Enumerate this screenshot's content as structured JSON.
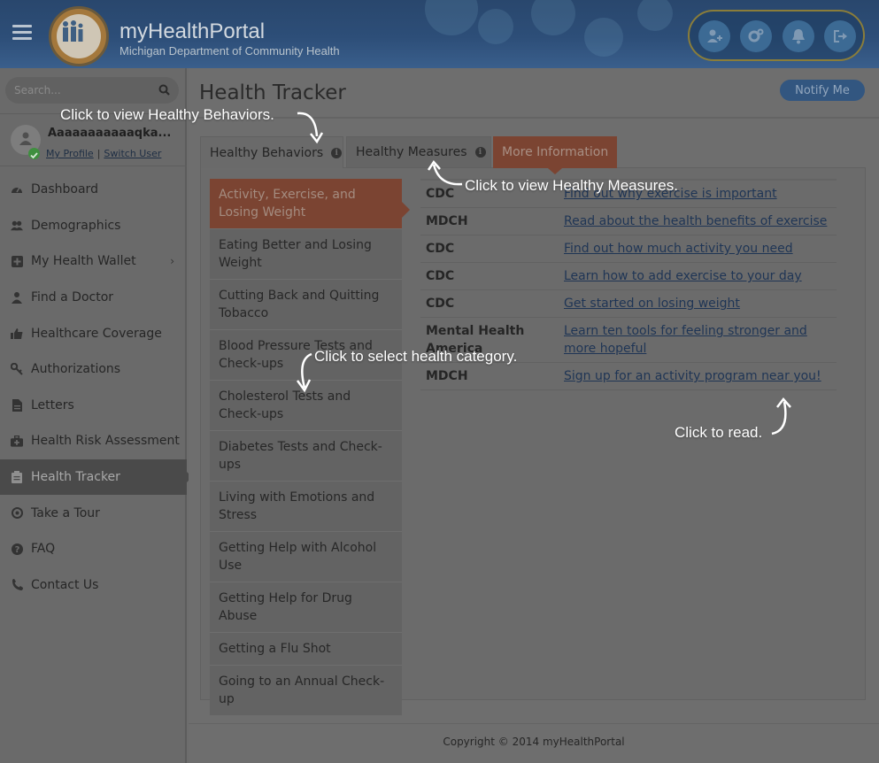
{
  "header": {
    "brand": "myHealthPortal",
    "subtitle": "Michigan Department of Community Health",
    "icons": [
      "add-user-icon",
      "settings-icon",
      "bell-icon",
      "logout-icon"
    ]
  },
  "search": {
    "placeholder": "Search..."
  },
  "profile": {
    "name": "Aaaaaaaaaaaqka...",
    "my_profile": "My Profile",
    "switch_user": "Switch User"
  },
  "nav": {
    "items": [
      {
        "label": "Dashboard",
        "icon": "dashboard-icon"
      },
      {
        "label": "Demographics",
        "icon": "users-icon"
      },
      {
        "label": "My Health Wallet",
        "icon": "plus-square-icon"
      },
      {
        "label": "Find a Doctor",
        "icon": "doctor-icon"
      },
      {
        "label": "Healthcare Coverage",
        "icon": "thumbs-up-icon"
      },
      {
        "label": "Authorizations",
        "icon": "key-icon"
      },
      {
        "label": "Letters",
        "icon": "file-icon"
      },
      {
        "label": "Health Risk Assessment",
        "icon": "medkit-icon"
      },
      {
        "label": "Health Tracker",
        "icon": "clipboard-icon"
      },
      {
        "label": "Take a Tour",
        "icon": "compass-icon"
      },
      {
        "label": "FAQ",
        "icon": "question-icon"
      },
      {
        "label": "Contact Us",
        "icon": "phone-icon"
      }
    ],
    "active": "Health Tracker"
  },
  "main": {
    "title": "Health Tracker",
    "notify_button": "Notify Me",
    "tabs": [
      {
        "label": "Healthy Behaviors"
      },
      {
        "label": "Healthy Measures"
      },
      {
        "label": "More Information"
      }
    ],
    "categories": [
      "Activity, Exercise, and Losing Weight",
      "Eating Better and Losing Weight",
      "Cutting Back and Quitting Tobacco",
      "Blood Pressure Tests and Check-ups",
      "Cholesterol Tests and Check-ups",
      "Diabetes Tests and Check-ups",
      "Living with Emotions and Stress",
      "Getting Help with Alcohol Use",
      "Getting Help for Drug Abuse",
      "Getting a Flu Shot",
      "Going to an Annual Check-up"
    ],
    "resources": [
      {
        "source": "CDC",
        "link": "Find out why exercise is important"
      },
      {
        "source": "MDCH",
        "link": "Read about the health benefits of exercise"
      },
      {
        "source": "CDC",
        "link": "Find out how much activity you need"
      },
      {
        "source": "CDC",
        "link": "Learn how to add exercise to your day"
      },
      {
        "source": "CDC",
        "link": "Get started on losing weight"
      },
      {
        "source": "Mental Health America",
        "link": "Learn ten tools for feeling stronger and more hopeful"
      },
      {
        "source": "MDCH",
        "link": "Sign up for an activity program near you!"
      }
    ]
  },
  "footer": {
    "copyright": "Copyright © 2014 myHealthPortal"
  },
  "callouts": {
    "behaviors": "Click to view Healthy Behaviors.",
    "measures": "Click to view Healthy Measures.",
    "category": "Click to select health category.",
    "read": "Click to read."
  }
}
